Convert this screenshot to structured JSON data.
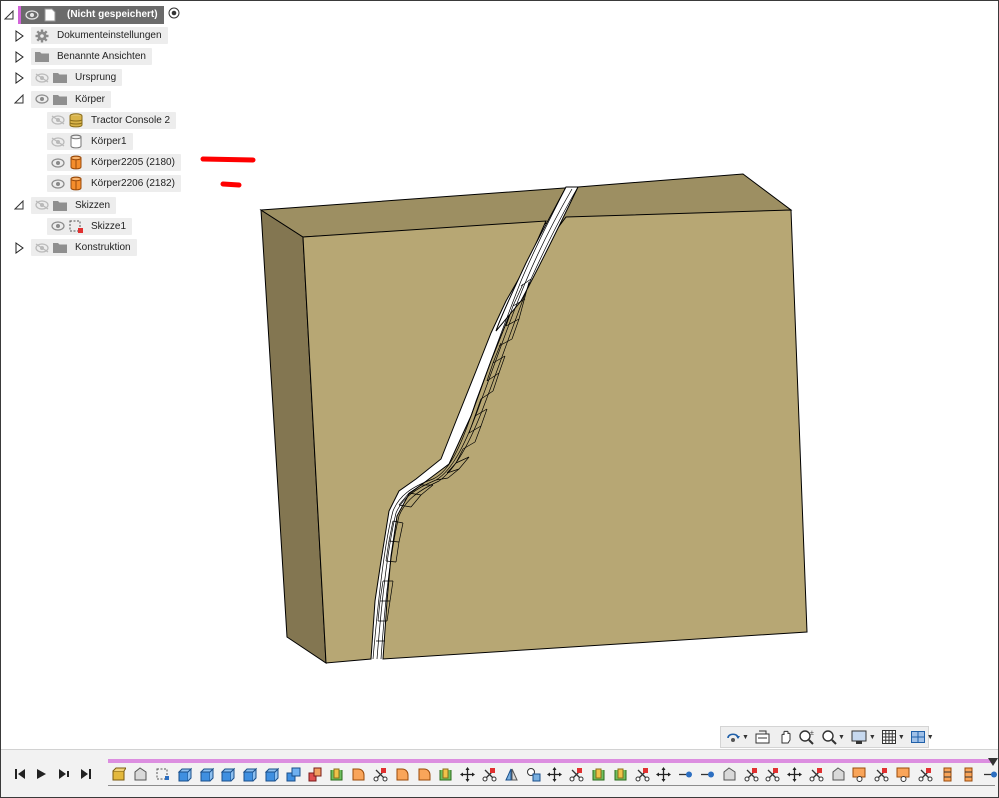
{
  "browser": {
    "root": {
      "label": "(Nicht gespeichert)"
    },
    "items": [
      {
        "label": "Dokumenteinstellungen",
        "icon": "gear-icon",
        "indent": 0,
        "expand": "collapsed",
        "eye": "none"
      },
      {
        "label": "Benannte Ansichten",
        "icon": "folder-icon",
        "indent": 0,
        "expand": "collapsed",
        "eye": "none"
      },
      {
        "label": "Ursprung",
        "icon": "folder-icon",
        "indent": 0,
        "expand": "collapsed",
        "eye": "hidden"
      },
      {
        "label": "Körper",
        "icon": "folder-icon",
        "indent": 0,
        "expand": "expanded",
        "eye": "visible"
      },
      {
        "label": "Tractor Console 2",
        "icon": "component-body-icon",
        "indent": 1,
        "expand": "none",
        "eye": "hidden"
      },
      {
        "label": "Körper1",
        "icon": "body-white-icon",
        "indent": 1,
        "expand": "none",
        "eye": "hidden"
      },
      {
        "label": "Körper2205 (2180)",
        "icon": "body-orange-icon",
        "indent": 1,
        "expand": "none",
        "eye": "visible"
      },
      {
        "label": "Körper2206 (2182)",
        "icon": "body-orange-icon",
        "indent": 1,
        "expand": "none",
        "eye": "visible"
      },
      {
        "label": "Skizzen",
        "icon": "folder-icon",
        "indent": 0,
        "expand": "expanded",
        "eye": "hidden"
      },
      {
        "label": "Skizze1",
        "icon": "sketch-icon",
        "indent": 1,
        "expand": "none",
        "eye": "visible"
      },
      {
        "label": "Konstruktion",
        "icon": "folder-icon",
        "indent": 0,
        "expand": "collapsed",
        "eye": "hidden"
      }
    ]
  },
  "annotations": [
    {
      "name": "red-marker-long",
      "color": "#ff0000"
    },
    {
      "name": "red-marker-short",
      "color": "#ff0000"
    }
  ],
  "model": {
    "front_color": "#b7a774",
    "side_color": "#837651",
    "top_color": "#9d8f62",
    "outline": "#000000"
  },
  "navbar": {
    "tools": [
      "orbit-icon",
      "look-at-icon",
      "pan-icon",
      "zoom-icon",
      "zoom-window-icon",
      "display-settings-icon",
      "grid-icon",
      "viewports-icon"
    ]
  },
  "timeline": {
    "controls": [
      "skip-to-start-icon",
      "play-icon",
      "step-forward-icon",
      "skip-to-end-icon"
    ],
    "colors": {
      "track": "#dc8ee0",
      "marker": "#333333"
    },
    "features": [
      "component",
      "box",
      "sketch",
      "extrude",
      "extrude",
      "extrude",
      "extrude",
      "extrude",
      "combine",
      "loft",
      "shell",
      "fillet",
      "split",
      "fillet",
      "fillet",
      "shell",
      "move",
      "split",
      "mirror",
      "joint",
      "move",
      "split",
      "shell",
      "shell",
      "split",
      "move",
      "point",
      "point",
      "box",
      "split",
      "split",
      "move",
      "split",
      "box",
      "sketch-joint",
      "split",
      "sketch-joint",
      "split",
      "section",
      "section",
      "point"
    ]
  }
}
